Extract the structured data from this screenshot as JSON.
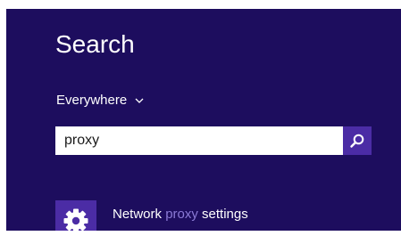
{
  "search_pane": {
    "title": "Search",
    "scope_label": "Everywhere",
    "query": "proxy",
    "results": [
      {
        "before": "Network ",
        "highlight": "proxy",
        "after": " settings",
        "icon": "gear-icon"
      }
    ]
  },
  "colors": {
    "background": "#1d0d5e",
    "accent": "#4b2ca5",
    "highlight_text": "#8b7ad6"
  }
}
